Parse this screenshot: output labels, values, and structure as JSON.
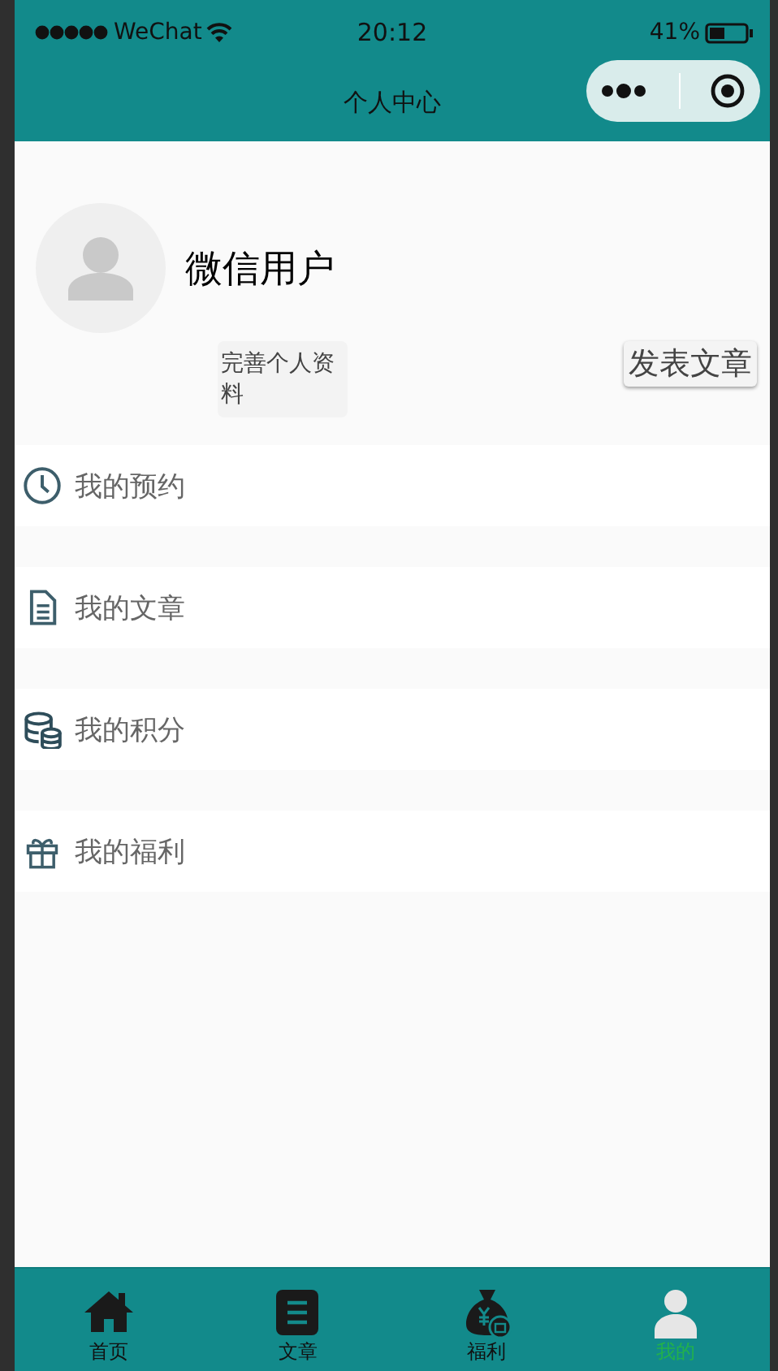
{
  "status_bar": {
    "carrier": "WeChat",
    "time": "20:12",
    "battery": "41%"
  },
  "nav_bar": {
    "title": "个人中心"
  },
  "profile": {
    "name": "微信用户",
    "edit_button": "完善个人资料",
    "post_button": "发表文章"
  },
  "menu": [
    {
      "kind": "clock",
      "label": "我的预约"
    },
    {
      "kind": "document",
      "label": "我的文章"
    },
    {
      "kind": "coins",
      "label": "我的积分"
    },
    {
      "kind": "gift",
      "label": "我的福利"
    }
  ],
  "tab_bar": [
    {
      "kind": "home",
      "label": "首页",
      "selected": false
    },
    {
      "kind": "article",
      "label": "文章",
      "selected": false
    },
    {
      "kind": "bag",
      "label": "福利",
      "selected": false
    },
    {
      "kind": "user",
      "label": "我的",
      "selected": true
    }
  ]
}
